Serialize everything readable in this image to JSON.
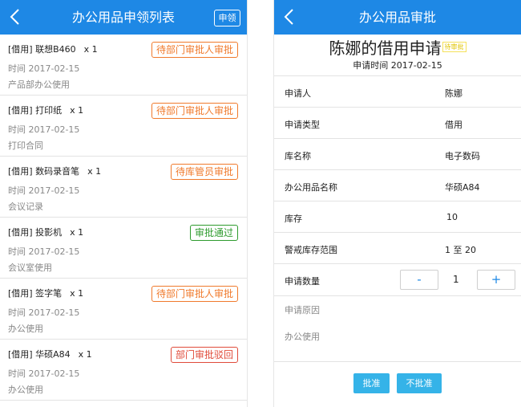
{
  "left": {
    "nav": {
      "title": "办公用品申领列表",
      "apply_label": "申领"
    },
    "items": [
      {
        "name": "[借用] 联想B460",
        "qty": "x 1",
        "time": "时间 2017-02-15",
        "note": "产品部办公使用",
        "status": "待部门审批人审批",
        "status_color": "#f07a2c"
      },
      {
        "name": "[借用] 打印纸",
        "qty": "x 1",
        "time": "时间 2017-02-15",
        "note": "打印合同",
        "status": "待部门审批人审批",
        "status_color": "#f07a2c"
      },
      {
        "name": "[借用] 数码录音笔",
        "qty": "x 1",
        "time": "时间 2017-02-15",
        "note": "会议记录",
        "status": "待库管员审批",
        "status_color": "#f07a2c"
      },
      {
        "name": "[借用] 投影机",
        "qty": "x 1",
        "time": "时间 2017-02-15",
        "note": "会议室使用",
        "status": "审批通过",
        "status_color": "#2e9b2e"
      },
      {
        "name": "[借用] 签字笔",
        "qty": "x 1",
        "time": "时间 2017-02-15",
        "note": "办公使用",
        "status": "待部门审批人审批",
        "status_color": "#f07a2c"
      },
      {
        "name": "[借用] 华硕A84",
        "qty": "x 1",
        "time": "时间 2017-02-15",
        "note": "办公使用",
        "status": "部门审批驳回",
        "status_color": "#e04b3a"
      }
    ]
  },
  "right": {
    "nav": {
      "title": "办公用品审批"
    },
    "header": {
      "title": "陈娜的借用申请",
      "status_tag": "待审批",
      "time": "申请时间 2017-02-15"
    },
    "fields": [
      {
        "label": "申请人",
        "value": "陈娜"
      },
      {
        "label": "申请类型",
        "value": "借用"
      },
      {
        "label": "库名称",
        "value": "电子数码"
      },
      {
        "label": "办公用品名称",
        "value": "华硕A84"
      },
      {
        "label": "库存",
        "value": "10"
      },
      {
        "label": "警戒库存范围",
        "value": "1 至 20"
      }
    ],
    "quantity": {
      "label": "申请数量",
      "minus": "-",
      "value": "1",
      "plus": "+"
    },
    "reason": {
      "label": "申请原因",
      "text": "办公使用"
    },
    "actions": {
      "approve": "批准",
      "reject": "不批准"
    }
  }
}
